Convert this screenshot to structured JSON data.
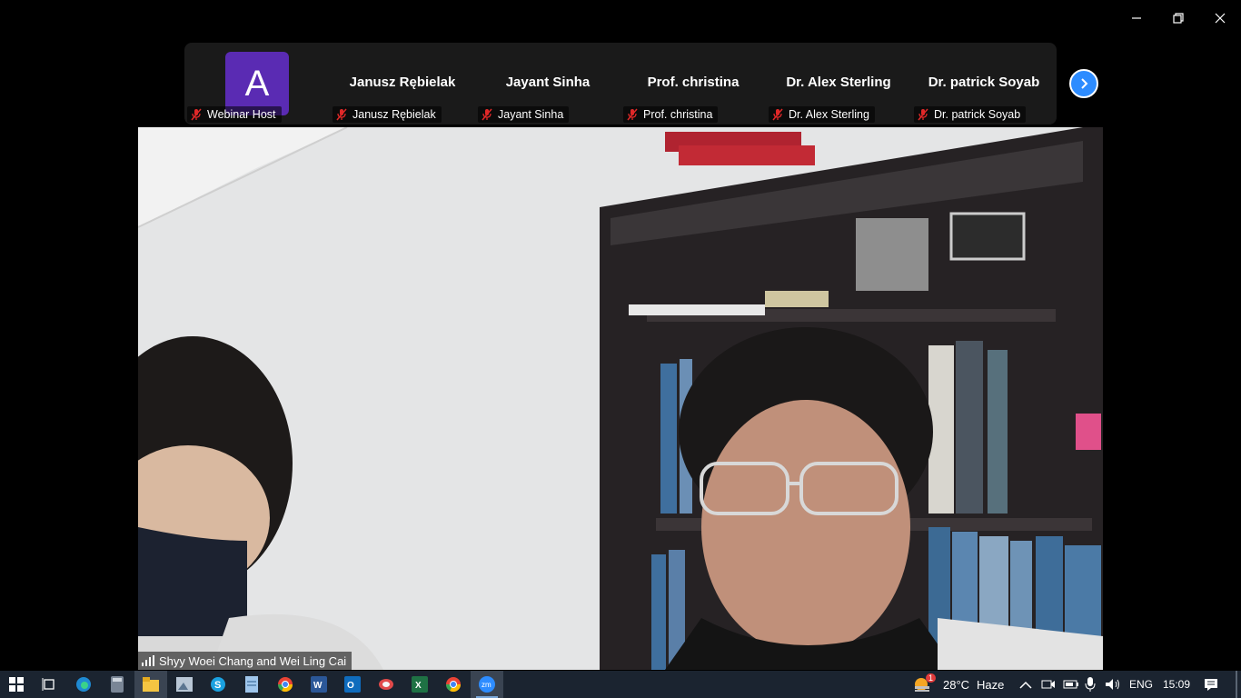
{
  "window_controls": {
    "minimize": "minimize-icon",
    "restore": "restore-icon",
    "close": "close-icon"
  },
  "participants": [
    {
      "display_name": "",
      "avatar_letter": "A",
      "label": "Webinar Host",
      "avatar_color": "#5a2bb3"
    },
    {
      "display_name": "Janusz Rębielak",
      "label": "Janusz Rębielak"
    },
    {
      "display_name": "Jayant Sinha",
      "label": "Jayant Sinha"
    },
    {
      "display_name": "Prof. christina",
      "label": "Prof. christina"
    },
    {
      "display_name": "Dr. Alex Sterling",
      "label": "Dr. Alex Sterling"
    },
    {
      "display_name": "Dr. patrick Soyab",
      "label": "Dr. patrick Soyab"
    }
  ],
  "active_speaker": {
    "label": "Shyy Woei Chang and Wei Ling Cai"
  },
  "taskbar": {
    "apps": [
      "windows-start-icon",
      "task-view-icon",
      "edge-icon",
      "calculator-icon",
      "file-explorer-icon",
      "photos-icon",
      "skype-icon",
      "notepad-icon",
      "chrome-icon",
      "word-icon",
      "outlook-icon",
      "snip-icon",
      "excel-icon",
      "chrome-profile-icon",
      "zoom-icon"
    ],
    "weather": {
      "temp": "28°C",
      "condition": "Haze",
      "badge": "1"
    },
    "language": "ENG",
    "time": "15:09"
  },
  "colors": {
    "accent": "#2d8cff",
    "taskbar": "#1b2430",
    "mic_muted": "#e02828"
  }
}
